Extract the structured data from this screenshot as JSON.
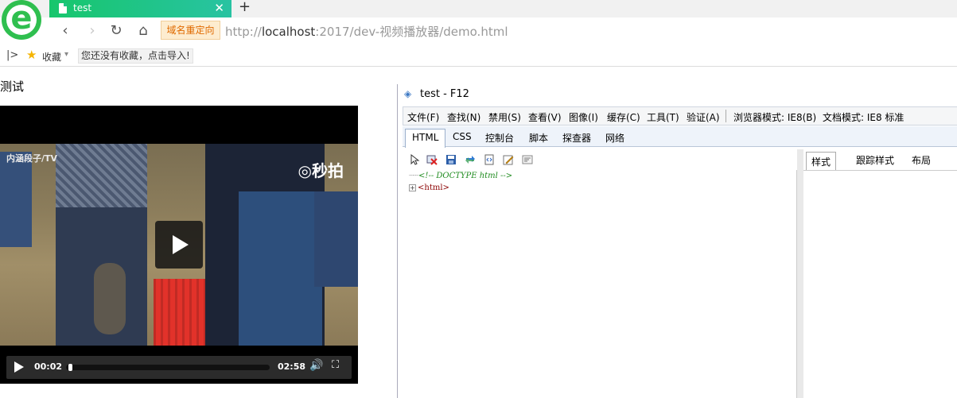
{
  "browser": {
    "tab_title": "test",
    "tab_close": "✕",
    "new_tab": "+",
    "url_tag": "域名重定向",
    "url_scheme": "http://",
    "url_host": "localhost",
    "url_rest": ":2017/dev-视频播放器/demo.html"
  },
  "bookmarks": {
    "label": "收藏",
    "hint": "您还没有收藏，点击导入!"
  },
  "page": {
    "text": "测试"
  },
  "video": {
    "watermark_left": "内涵段子/TV",
    "watermark_right": "◎秒拍",
    "current_time": "00:02",
    "duration": "02:58",
    "progress": 0.011
  },
  "devtools": {
    "window_title": "test - F12",
    "menu": [
      "文件(F)",
      "查找(N)",
      "禁用(S)",
      "查看(V)",
      "图像(I)",
      "缓存(C)",
      "工具(T)",
      "验证(A)"
    ],
    "browser_mode": "浏览器模式: IE8(B)",
    "document_mode": "文档模式: IE8 标准",
    "tabs": [
      "HTML",
      "CSS",
      "控制台",
      "脚本",
      "探查器",
      "网络"
    ],
    "active_tab": "HTML",
    "tree": {
      "doctype_comment": "<!-- DOCTYPE html -->",
      "html_node": "<html>",
      "expand": "+"
    },
    "right_tabs": [
      "样式",
      "跟踪样式",
      "布局"
    ],
    "active_right_tab": "样式"
  },
  "colors": {
    "tab_gradient_start": "#17c66c",
    "tab_gradient_end": "#28c3a2",
    "url_tag_text": "#e06a00",
    "crate": "#e2322a"
  }
}
